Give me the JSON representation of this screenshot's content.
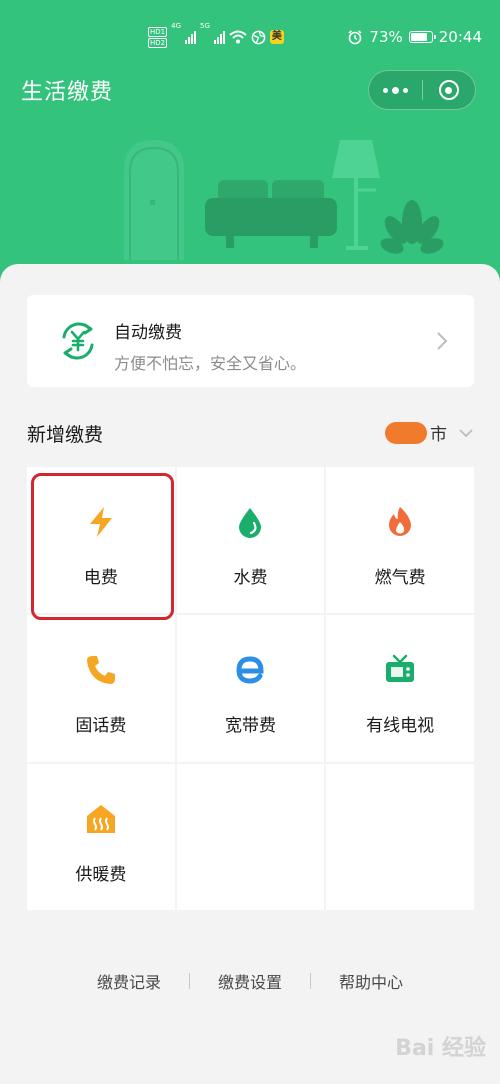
{
  "statusbar": {
    "net1": "4G",
    "net2": "5G",
    "badge": "美",
    "battery": "73%",
    "battery_level": 0.73,
    "time": "20:44"
  },
  "header": {
    "title": "生活缴费"
  },
  "auto_pay": {
    "title": "自动缴费",
    "subtitle": "方便不怕忘，安全又省心。"
  },
  "section": {
    "title": "新增缴费",
    "city_suffix": "市"
  },
  "services": [
    {
      "label": "电费",
      "icon": "lightning-icon",
      "color": "#f5a623"
    },
    {
      "label": "水费",
      "icon": "water-drop-icon",
      "color": "#1aad6b"
    },
    {
      "label": "燃气费",
      "icon": "flame-icon",
      "color": "#f26b3a"
    },
    {
      "label": "固话费",
      "icon": "phone-icon",
      "color": "#f5a623"
    },
    {
      "label": "宽带费",
      "icon": "broadband-e-icon",
      "color": "#2b8fe6"
    },
    {
      "label": "有线电视",
      "icon": "tv-icon",
      "color": "#1aad6b"
    },
    {
      "label": "供暖费",
      "icon": "heating-icon",
      "color": "#f5a623"
    }
  ],
  "footer": {
    "records": "缴费记录",
    "settings": "缴费设置",
    "help": "帮助中心"
  },
  "watermark": "Bai 经验",
  "colors": {
    "brand": "#34c37d",
    "highlight": "#d3262f"
  }
}
